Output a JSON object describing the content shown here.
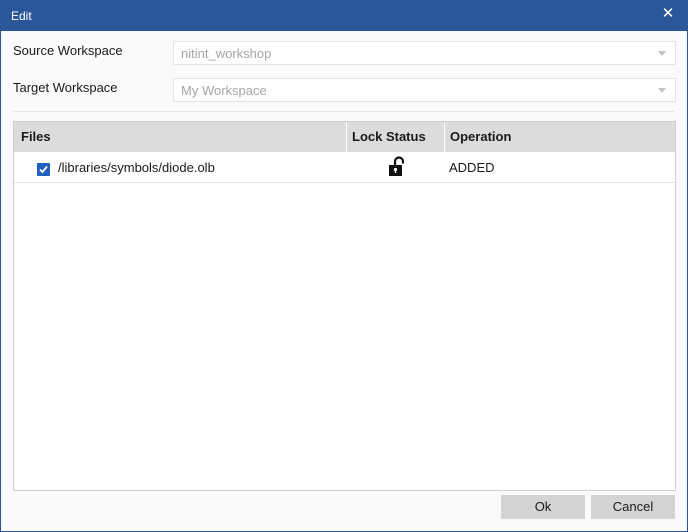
{
  "window": {
    "title": "Edit",
    "close_icon": "close-icon"
  },
  "form": {
    "source_label": "Source Workspace",
    "source_value": "nitint_workshop",
    "target_label": "Target Workspace",
    "target_value": "My Workspace"
  },
  "grid": {
    "columns": [
      "Files",
      "Lock Status",
      "Operation"
    ],
    "rows": [
      {
        "checked": true,
        "file": "/libraries/symbols/diode.olb",
        "lock_icon": "unlocked-padlock-icon",
        "operation": "ADDED"
      }
    ]
  },
  "buttons": {
    "ok": "Ok",
    "cancel": "Cancel"
  }
}
